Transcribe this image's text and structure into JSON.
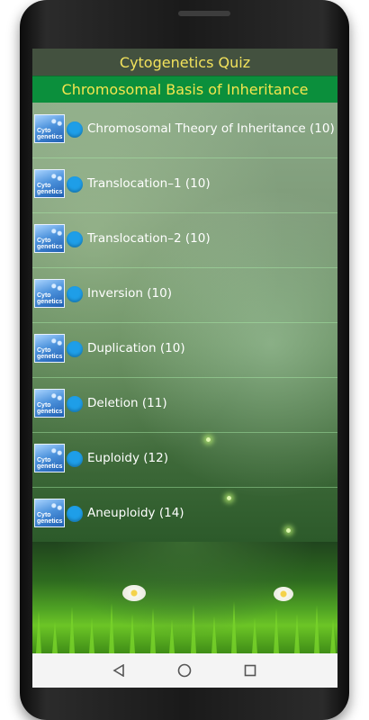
{
  "header": {
    "app_title": "Cytogenetics Quiz",
    "section_title": "Chromosomal Basis of Inheritance"
  },
  "thumbnail": {
    "label": "Cyto\ngenetics"
  },
  "topics": [
    {
      "label": "Chromosomal Theory of Inheritance (10)"
    },
    {
      "label": "Translocation–1 (10)"
    },
    {
      "label": "Translocation–2 (10)"
    },
    {
      "label": "Inversion (10)"
    },
    {
      "label": "Duplication (10)"
    },
    {
      "label": "Deletion (11)"
    },
    {
      "label": "Euploidy (12)"
    },
    {
      "label": "Aneuploidy (14)"
    }
  ],
  "navbar": {
    "back_icon": "triangle-left",
    "home_icon": "circle",
    "recents_icon": "square"
  },
  "colors": {
    "app_bar": "#43513f",
    "subheader": "#0b8f3c",
    "title_text": "#f2e25c",
    "bullet": "#1e9ee8"
  }
}
